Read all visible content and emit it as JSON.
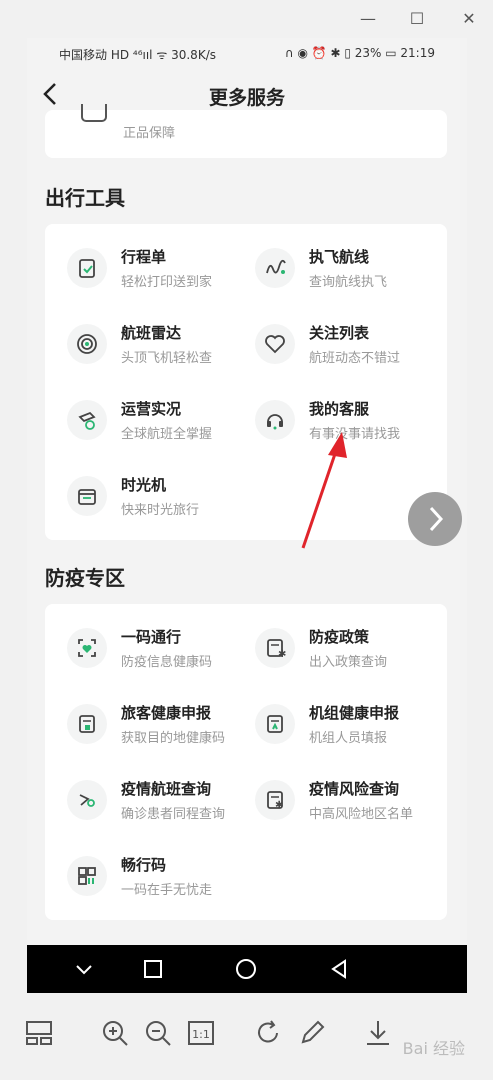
{
  "status": {
    "left": "中国移动 HD ⁴⁶ııl ᯤ 30.8K/s",
    "right": "∩ ◉ ⏰ ✱ ▯ 23% ▭ 21:19"
  },
  "header": {
    "title": "更多服务"
  },
  "top_card": {
    "sub": "正品保障"
  },
  "sections": [
    {
      "title": "出行工具",
      "items": [
        {
          "name": "行程单",
          "sub": "轻松打印送到家",
          "icon": "itinerary-icon"
        },
        {
          "name": "执飞航线",
          "sub": "查询航线执飞",
          "icon": "route-icon"
        },
        {
          "name": "航班雷达",
          "sub": "头顶飞机轻松查",
          "icon": "radar-icon"
        },
        {
          "name": "关注列表",
          "sub": "航班动态不错过",
          "icon": "heart-icon"
        },
        {
          "name": "运营实况",
          "sub": "全球航班全掌握",
          "icon": "operations-icon"
        },
        {
          "name": "我的客服",
          "sub": "有事没事请找我",
          "icon": "headset-icon"
        },
        {
          "name": "时光机",
          "sub": "快来时光旅行",
          "icon": "calendar-icon"
        }
      ]
    },
    {
      "title": "防疫专区",
      "items": [
        {
          "name": "一码通行",
          "sub": "防疫信息健康码",
          "icon": "scan-icon"
        },
        {
          "name": "防疫政策",
          "sub": "出入政策查询",
          "icon": "policy-icon"
        },
        {
          "name": "旅客健康申报",
          "sub": "获取目的地健康码",
          "icon": "health-report-icon"
        },
        {
          "name": "机组健康申报",
          "sub": "机组人员填报",
          "icon": "crew-report-icon"
        },
        {
          "name": "疫情航班查询",
          "sub": "确诊患者同程查询",
          "icon": "flight-search-icon"
        },
        {
          "name": "疫情风险查询",
          "sub": "中高风险地区名单",
          "icon": "risk-icon"
        },
        {
          "name": "畅行码",
          "sub": "一码在手无忧走",
          "icon": "qr-icon"
        }
      ]
    }
  ],
  "watermark": "Bai 经验",
  "colors": {
    "accent": "#2bb673",
    "annotation": "#e0242b"
  }
}
